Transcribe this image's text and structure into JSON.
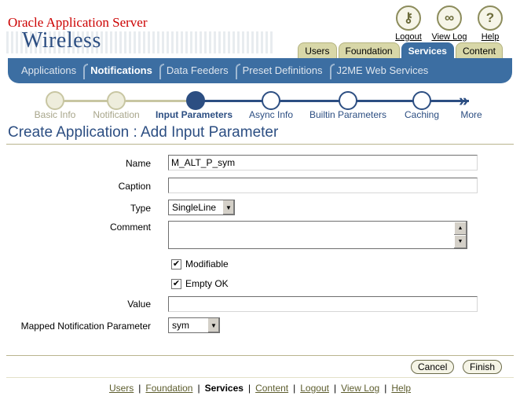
{
  "brand": {
    "line1": "Oracle Application Server",
    "line2": "Wireless"
  },
  "global_links": [
    {
      "label": "Logout",
      "icon": "key-icon"
    },
    {
      "label": "View Log",
      "icon": "glasses-icon"
    },
    {
      "label": "Help",
      "icon": "question-icon"
    }
  ],
  "tabs": [
    {
      "label": "Users",
      "active": false
    },
    {
      "label": "Foundation",
      "active": false
    },
    {
      "label": "Services",
      "active": true
    },
    {
      "label": "Content",
      "active": false
    }
  ],
  "subtabs": [
    {
      "label": "Applications",
      "active": false
    },
    {
      "label": "Notifications",
      "active": true
    },
    {
      "label": "Data Feeders",
      "active": false
    },
    {
      "label": "Preset Definitions",
      "active": false
    },
    {
      "label": "J2ME Web Services",
      "active": false
    }
  ],
  "train": {
    "steps": [
      {
        "label": "Basic Info",
        "state": "visited"
      },
      {
        "label": "Notification",
        "state": "visited"
      },
      {
        "label": "Input Parameters",
        "state": "current"
      },
      {
        "label": "Async Info",
        "state": "next"
      },
      {
        "label": "Builtin Parameters",
        "state": "next"
      },
      {
        "label": "Caching",
        "state": "next"
      }
    ],
    "more_label": "More"
  },
  "page_title": "Create Application : Add Input Parameter",
  "form": {
    "name_label": "Name",
    "name_value": "M_ALT_P_sym",
    "caption_label": "Caption",
    "caption_value": "",
    "type_label": "Type",
    "type_value": "SingleLine",
    "comment_label": "Comment",
    "comment_value": "",
    "modifiable_label": "Modifiable",
    "modifiable_checked": true,
    "emptyok_label": "Empty OK",
    "emptyok_checked": true,
    "value_label": "Value",
    "value_value": "",
    "mapped_label": "Mapped Notification Parameter",
    "mapped_value": "sym"
  },
  "buttons": {
    "cancel": "Cancel",
    "finish": "Finish"
  },
  "footer_links": [
    {
      "label": "Users",
      "current": false
    },
    {
      "label": "Foundation",
      "current": false
    },
    {
      "label": "Services",
      "current": true
    },
    {
      "label": "Content",
      "current": false
    },
    {
      "label": "Logout",
      "current": false
    },
    {
      "label": "View Log",
      "current": false
    },
    {
      "label": "Help",
      "current": false
    }
  ],
  "colors": {
    "accent_blue": "#3c6ea2",
    "title_blue": "#2c4e82",
    "tab_khaki": "#d8d7a8",
    "brand_red": "#cc0000"
  }
}
